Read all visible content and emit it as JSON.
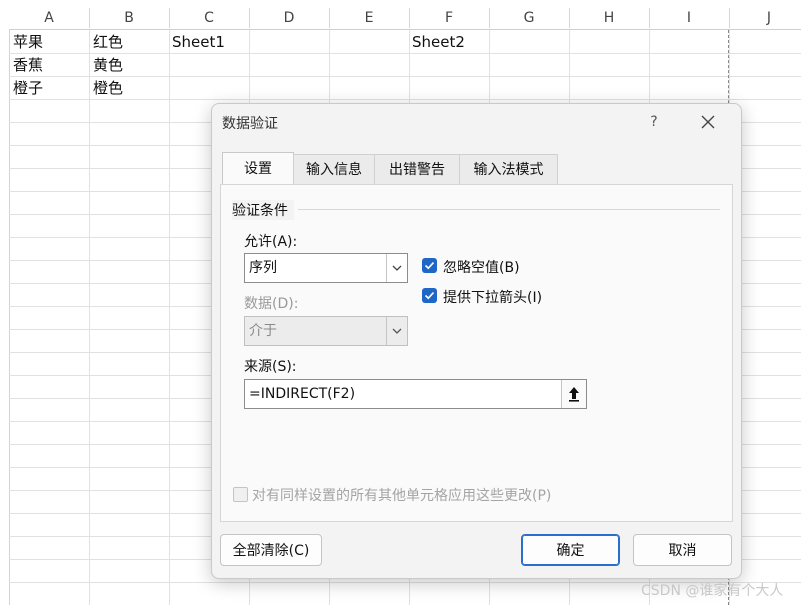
{
  "sheet": {
    "columns": [
      "A",
      "B",
      "C",
      "D",
      "E",
      "F",
      "G",
      "H",
      "I",
      "J"
    ],
    "cells": {
      "A1": "苹果",
      "B1": "红色",
      "C1": "Sheet1",
      "F1": "Sheet2",
      "A2": "香蕉",
      "B2": "黄色",
      "A3": "橙子",
      "B3": "橙色"
    }
  },
  "dialog": {
    "title": "数据验证",
    "help_label": "?",
    "tabs": [
      "设置",
      "输入信息",
      "出错警告",
      "输入法模式"
    ],
    "active_tab": 0,
    "group_title": "验证条件",
    "allow": {
      "label": "允许(A):",
      "value": "序列"
    },
    "data": {
      "label": "数据(D):",
      "value": "介于",
      "disabled": true
    },
    "ignore_blank": {
      "label": "忽略空值(B)",
      "checked": true
    },
    "dropdown": {
      "label": "提供下拉箭头(I)",
      "checked": true
    },
    "source": {
      "label": "来源(S):",
      "value": "=INDIRECT(F2)"
    },
    "apply_all": {
      "label": "对有同样设置的所有其他单元格应用这些更改(P)",
      "checked": false,
      "disabled": true
    },
    "buttons": {
      "clear_all": "全部清除(C)",
      "ok": "确定",
      "cancel": "取消"
    }
  },
  "watermark": "CSDN @谁家有个大人",
  "colors": {
    "checkbox": "#1f67c7",
    "primary_border": "#2a6fcd"
  }
}
